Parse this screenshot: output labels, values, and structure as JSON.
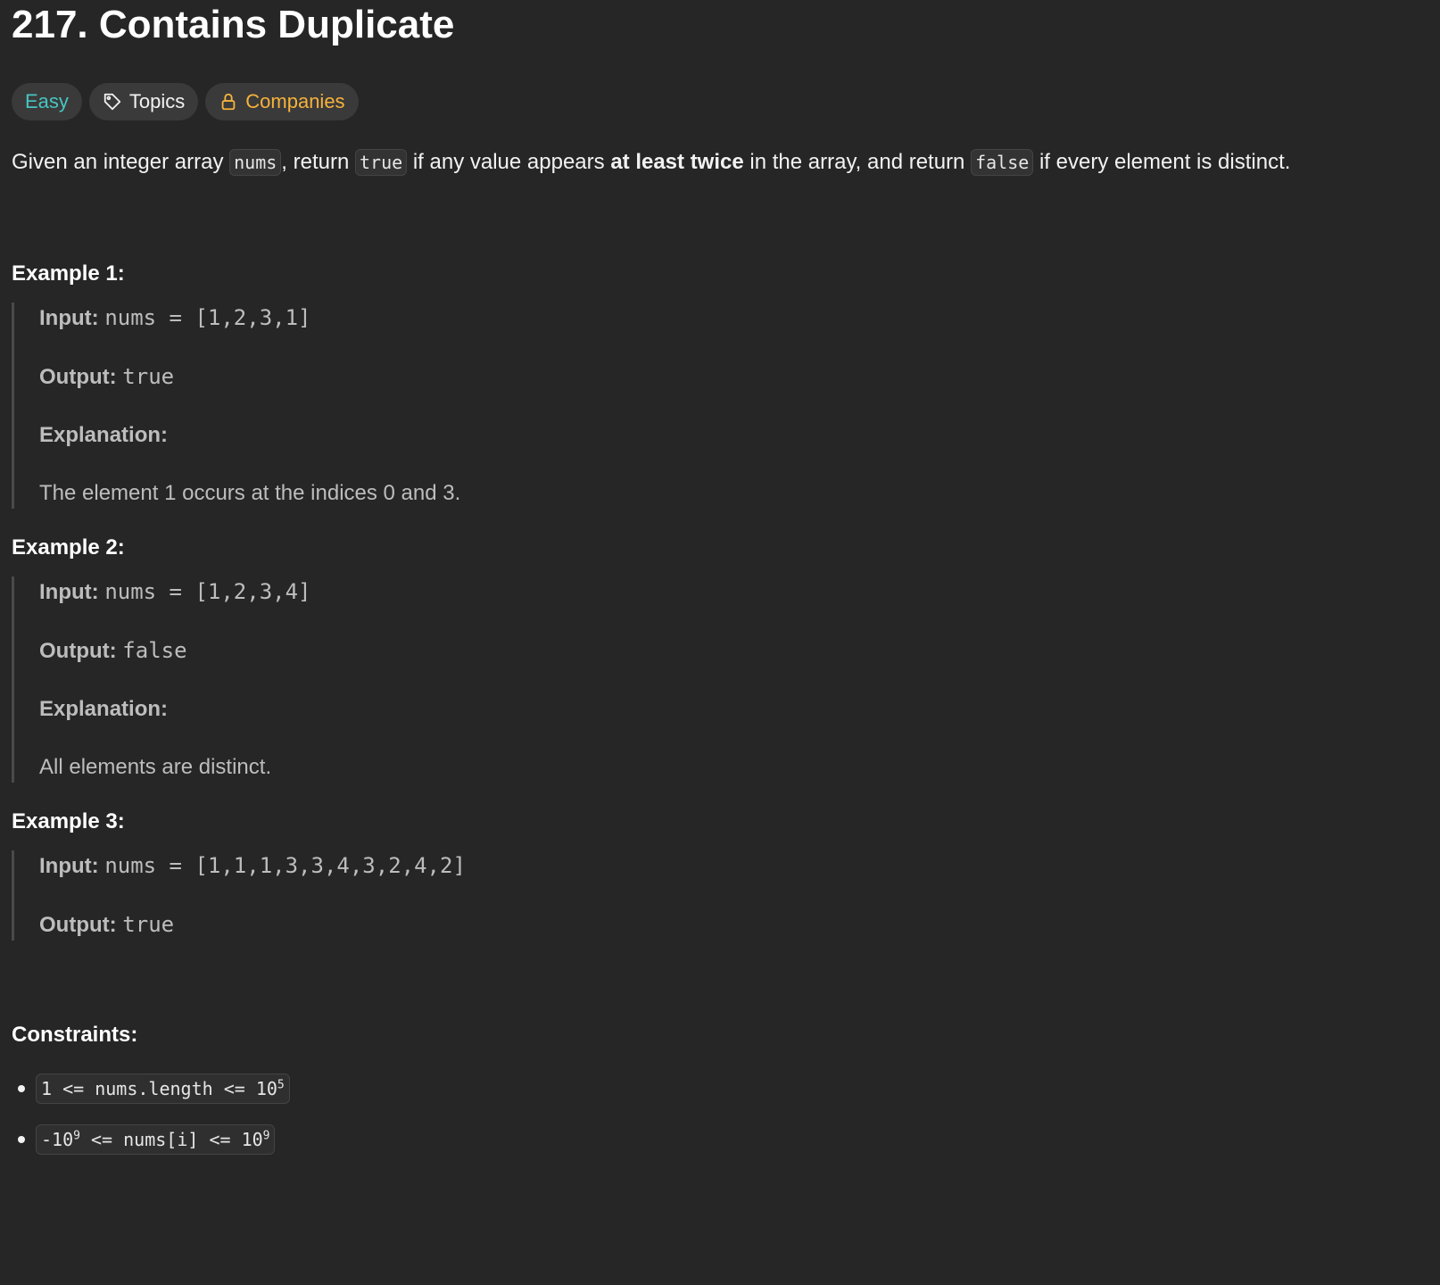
{
  "problem": {
    "title": "217. Contains Duplicate",
    "difficulty": "Easy",
    "tags": {
      "topics": "Topics",
      "companies": "Companies"
    },
    "description": {
      "p1": "Given an integer array ",
      "c1": "nums",
      "p2": ", return ",
      "c2": "true",
      "p3": " if any value appears ",
      "bold": "at least twice",
      "p4": " in the array, and return ",
      "c3": "false",
      "p5": " if every element is distinct."
    }
  },
  "labels": {
    "input": "Input:",
    "output": "Output:",
    "explanation": "Explanation:"
  },
  "examples": [
    {
      "title": "Example 1:",
      "input": "nums = [1,2,3,1]",
      "output": "true",
      "explanation": "The element 1 occurs at the indices 0 and 3."
    },
    {
      "title": "Example 2:",
      "input": "nums = [1,2,3,4]",
      "output": "false",
      "explanation": "All elements are distinct."
    },
    {
      "title": "Example 3:",
      "input": "nums = [1,1,1,3,3,4,3,2,4,2]",
      "output": "true"
    }
  ],
  "constraints": {
    "title": "Constraints:",
    "items": [
      {
        "pre": "1 <= nums.length <= 10",
        "exp": "5",
        "post": ""
      },
      {
        "pre": "-10",
        "exp": "9",
        "mid": " <= nums[i] <= 10",
        "exp2": "9"
      }
    ]
  },
  "colors": {
    "background": "#262626",
    "easy": "#46c6c2",
    "companies": "#f7b23b"
  },
  "icons": {
    "topics": "tag-icon",
    "companies": "lock-icon"
  }
}
